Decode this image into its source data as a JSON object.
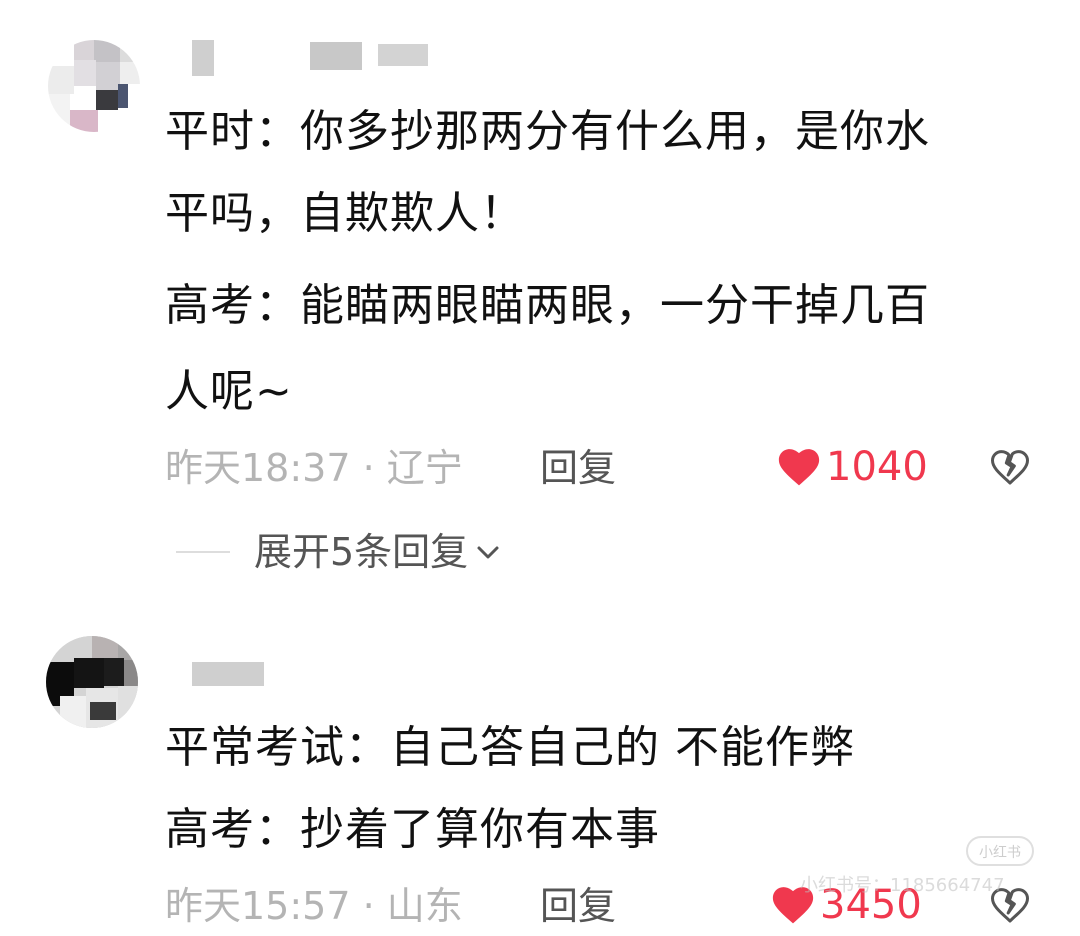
{
  "comments": [
    {
      "text_lines": [
        "平时：你多抄那两分有什么用，是你水",
        "平吗，自欺欺人！",
        "高考：能瞄两眼瞄两眼，一分干掉几百",
        "人呢~"
      ],
      "time_location": "昨天18:37 · 辽宁",
      "reply_label": "回复",
      "like_count": "1040",
      "expand_label": "展开5条回复"
    },
    {
      "text_lines": [
        "平常考试：自己答自己的 不能作弊",
        "高考：抄着了算你有本事"
      ],
      "time_location": "昨天15:57 · 山东",
      "reply_label": "回复",
      "like_count": "3450"
    }
  ],
  "watermark": {
    "logo_text": "小红书",
    "id_text": "小红书号：1185664747"
  },
  "icons": {
    "like": "heart-icon",
    "dislike": "broken-heart-icon",
    "expand": "chevron-down-icon"
  },
  "colors": {
    "text": "#111111",
    "meta": "#b4b4b4",
    "action": "#555555",
    "like": "#f0384e"
  }
}
